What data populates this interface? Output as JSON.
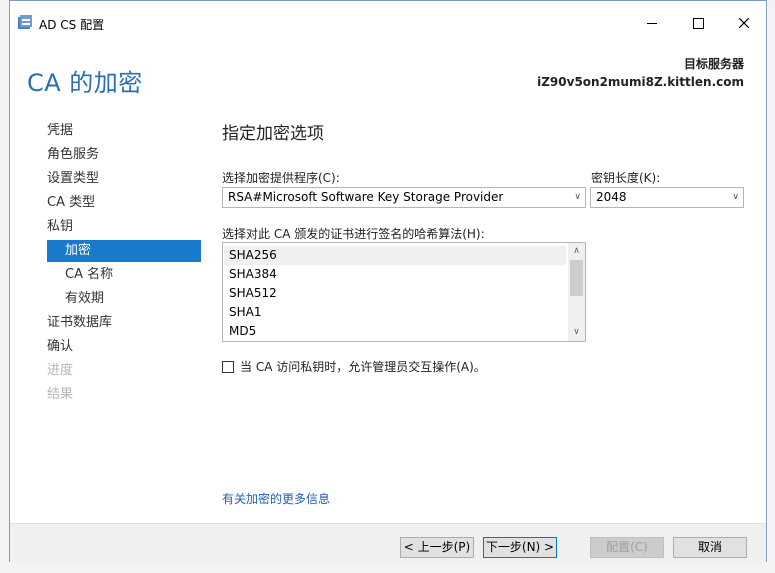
{
  "window": {
    "title": "AD CS 配置"
  },
  "header": {
    "page_title": "CA 的加密",
    "server_label": "目标服务器",
    "server_name": "iZ90v5on2mumi8Z.kittlen.com"
  },
  "nav": {
    "items": [
      {
        "label": "凭据",
        "state": "normal"
      },
      {
        "label": "角色服务",
        "state": "normal"
      },
      {
        "label": "设置类型",
        "state": "normal"
      },
      {
        "label": "CA 类型",
        "state": "normal"
      },
      {
        "label": "私钥",
        "state": "normal"
      },
      {
        "label": "加密",
        "state": "selected"
      },
      {
        "label": "CA 名称",
        "state": "normal"
      },
      {
        "label": "有效期",
        "state": "normal"
      },
      {
        "label": "证书数据库",
        "state": "normal"
      },
      {
        "label": "确认",
        "state": "normal"
      },
      {
        "label": "进度",
        "state": "disabled"
      },
      {
        "label": "结果",
        "state": "disabled"
      }
    ]
  },
  "content": {
    "title": "指定加密选项",
    "provider_label": "选择加密提供程序(C):",
    "provider_value": "RSA#Microsoft Software Key Storage Provider",
    "key_length_label": "密钥长度(K):",
    "key_length_value": "2048",
    "hash_label": "选择对此 CA 颁发的证书进行签名的哈希算法(H):",
    "hash_options": [
      "SHA256",
      "SHA384",
      "SHA512",
      "SHA1",
      "MD5"
    ],
    "hash_selected": "SHA256",
    "interact_label": "当 CA 访问私钥时，允许管理员交互操作(A)。",
    "interact_checked": false,
    "more_info_link": "有关加密的更多信息"
  },
  "footer": {
    "back_label": "< 上一步(P)",
    "next_label": "下一步(N) >",
    "configure_label": "配置(C)",
    "cancel_label": "取消"
  },
  "colors": {
    "accent": "#1979ca",
    "title_blue": "#2b6db1",
    "link": "#1f61b3"
  }
}
